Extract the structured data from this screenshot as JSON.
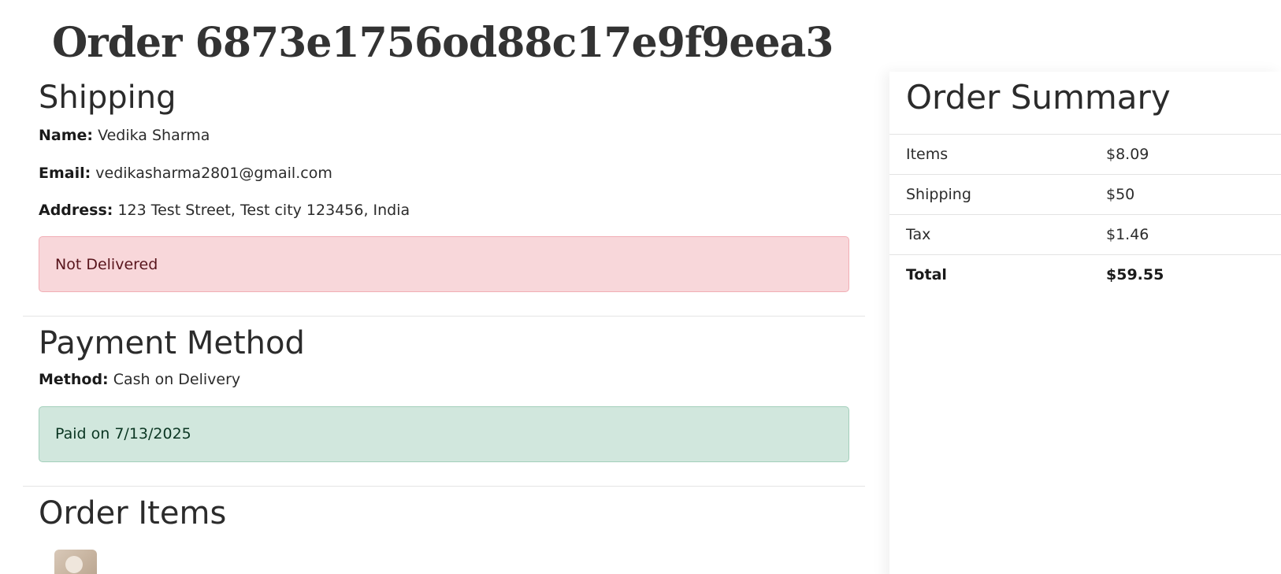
{
  "order": {
    "title": "Order 6873e1756od88c17e9f9eea3"
  },
  "shipping": {
    "heading": "Shipping",
    "name_label": "Name:",
    "name_value": "Vedika Sharma",
    "email_label": "Email:",
    "email_value": "vedikasharma2801@gmail.com",
    "address_label": "Address:",
    "address_value": "123 Test Street, Test city 123456, India",
    "status": "Not Delivered"
  },
  "payment": {
    "heading": "Payment Method",
    "method_label": "Method:",
    "method_value": "Cash on Delivery",
    "status": "Paid on 7/13/2025"
  },
  "items": {
    "heading": "Order Items"
  },
  "summary": {
    "heading": "Order Summary",
    "rows": [
      {
        "label": "Items",
        "value": "$8.09"
      },
      {
        "label": "Shipping",
        "value": "$50"
      },
      {
        "label": "Tax",
        "value": "$1.46"
      },
      {
        "label": "Total",
        "value": "$59.55"
      }
    ]
  },
  "colors": {
    "danger_bg": "#f8d7da",
    "success_bg": "#d1e7dd",
    "text": "#2b2b2b"
  },
  "icons": {
    "item_thumbnail": "product-thumbnail-image"
  }
}
